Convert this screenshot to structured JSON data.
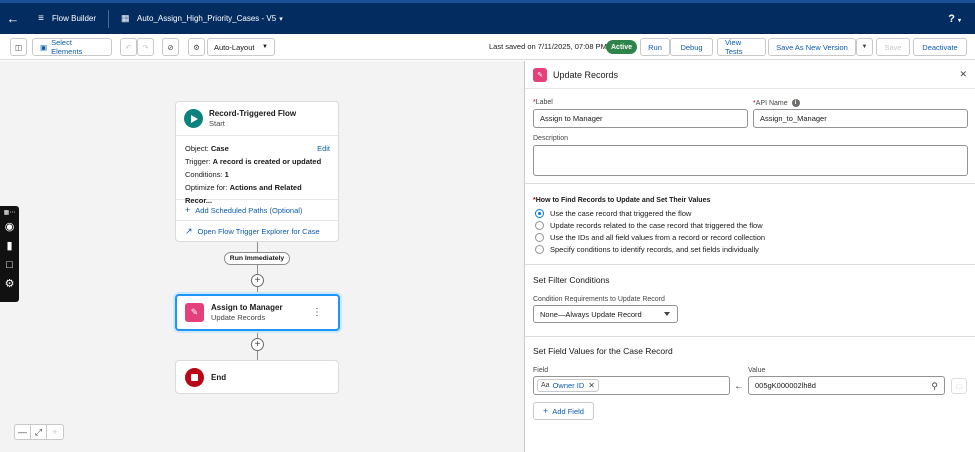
{
  "topbar": {
    "back_icon": "back-arrow-icon",
    "app_icon": "flow-builder-icon",
    "app_name": "Flow Builder",
    "flow_icon": "flow-icon",
    "flow_name": "Auto_Assign_High_Priority_Cases - V5",
    "help_label": "?"
  },
  "toolbar": {
    "select_elements": "Select Elements",
    "auto_layout": "Auto-Layout",
    "last_saved": "Last saved on 7/11/2025, 07:08 PM",
    "status": "Active",
    "run": "Run",
    "debug": "Debug",
    "view_tests": "View Tests",
    "save_as_new_version": "Save As New Version",
    "save": "Save",
    "deactivate": "Deactivate"
  },
  "canvas": {
    "start": {
      "title": "Record-Triggered Flow",
      "subtitle": "Start",
      "object_label": "Object: ",
      "object_value": "Case",
      "edit": "Edit",
      "trigger_label": "Trigger: ",
      "trigger_value": "A record is created or updated",
      "conditions_label": "Conditions: ",
      "conditions_value": "1",
      "optimize_label": "Optimize for: ",
      "optimize_value": "Actions and Related Recor...",
      "add_scheduled": "Add Scheduled Paths (Optional)",
      "open_explorer": "Open Flow Trigger Explorer for Case"
    },
    "run_immediately": "Run Immediately",
    "assign": {
      "title": "Assign to Manager",
      "subtitle": "Update Records"
    },
    "end": {
      "title": "End"
    }
  },
  "panel": {
    "title": "Update Records",
    "label_caption": "Label",
    "label_value": "Assign to Manager",
    "api_caption": "API Name",
    "api_value": "Assign_to_Manager",
    "description_caption": "Description",
    "description_value": "",
    "how_to_find": "How to Find Records to Update and Set Their Values",
    "options": [
      "Use the case record that triggered the flow",
      "Update records related to the case record that triggered the flow",
      "Use the IDs and all field values from a record or record collection",
      "Specify conditions to identify records, and set fields individually"
    ],
    "filter_title": "Set Filter Conditions",
    "condition_caption": "Condition Requirements to Update Record",
    "condition_value": "None—Always Update Record",
    "set_fields_title": "Set Field Values for the Case Record",
    "field_caption": "Field",
    "value_caption": "Value",
    "field_value": "Owner ID",
    "field_type_glyph": "Aa",
    "value_value": "005gK000002lh8d",
    "add_field": "Add Field"
  },
  "colors": {
    "header": "#032d60",
    "brand": "#0b5cab",
    "active": "#2e844a",
    "start_icon": "#0b827c",
    "update_icon": "#e4407c",
    "end_icon": "#ba0517"
  }
}
